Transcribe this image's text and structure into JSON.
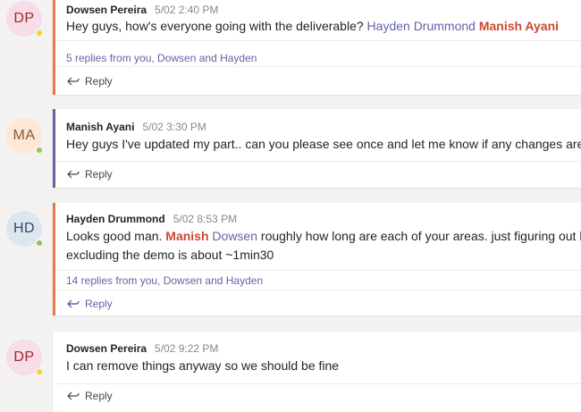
{
  "threads": [
    {
      "avatar": {
        "initials": "DP",
        "bg": "#f6dde8",
        "fg": "#a4262c",
        "status": "away",
        "status_color": "#f8d22a"
      },
      "accent": "#e97548",
      "author": "Dowsen Pereira",
      "time": "5/02 2:40 PM",
      "text": "Hey guys, how's everyone going with the deliverable?",
      "mention_blue": "Hayden Drummond",
      "mention_red": "Manish Ayani",
      "replies": "5 replies from you, Dowsen and Hayden",
      "reply_label": "Reply"
    },
    {
      "avatar": {
        "initials": "MA",
        "bg": "#fde7d6",
        "fg": "#8e562e",
        "status": "available",
        "status_color": "#92c353"
      },
      "accent": "#6264a7",
      "author": "Manish Ayani",
      "time": "5/02 3:30 PM",
      "text": "Hey guys I've updated my part.. can you please see once and let me know if any changes are ne",
      "reply_label": "Reply"
    },
    {
      "avatar": {
        "initials": "HD",
        "bg": "#dbe6ee",
        "fg": "#2d4b6b",
        "status": "available",
        "status_color": "#92c353"
      },
      "accent": "#e97548",
      "author": "Hayden Drummond",
      "time": "5/02 8:53 PM",
      "text_pre": "Looks good man.",
      "mention_red": "Manish",
      "mention_blue": "Dowsen",
      "text_post": "roughly how long are each of your areas. just figuring out h",
      "text_line2": "excluding the demo is about ~1min30",
      "replies": "14 replies from you, Dowsen and Hayden",
      "reply_label": "Reply"
    },
    {
      "avatar": {
        "initials": "DP",
        "bg": "#f6dde8",
        "fg": "#a4262c",
        "status": "away",
        "status_color": "#f8d22a"
      },
      "accent": "#ffffff",
      "author": "Dowsen Pereira",
      "time": "5/02 9:22 PM",
      "text": "I can remove things anyway so we should be fine",
      "reply_label": "Reply"
    }
  ]
}
